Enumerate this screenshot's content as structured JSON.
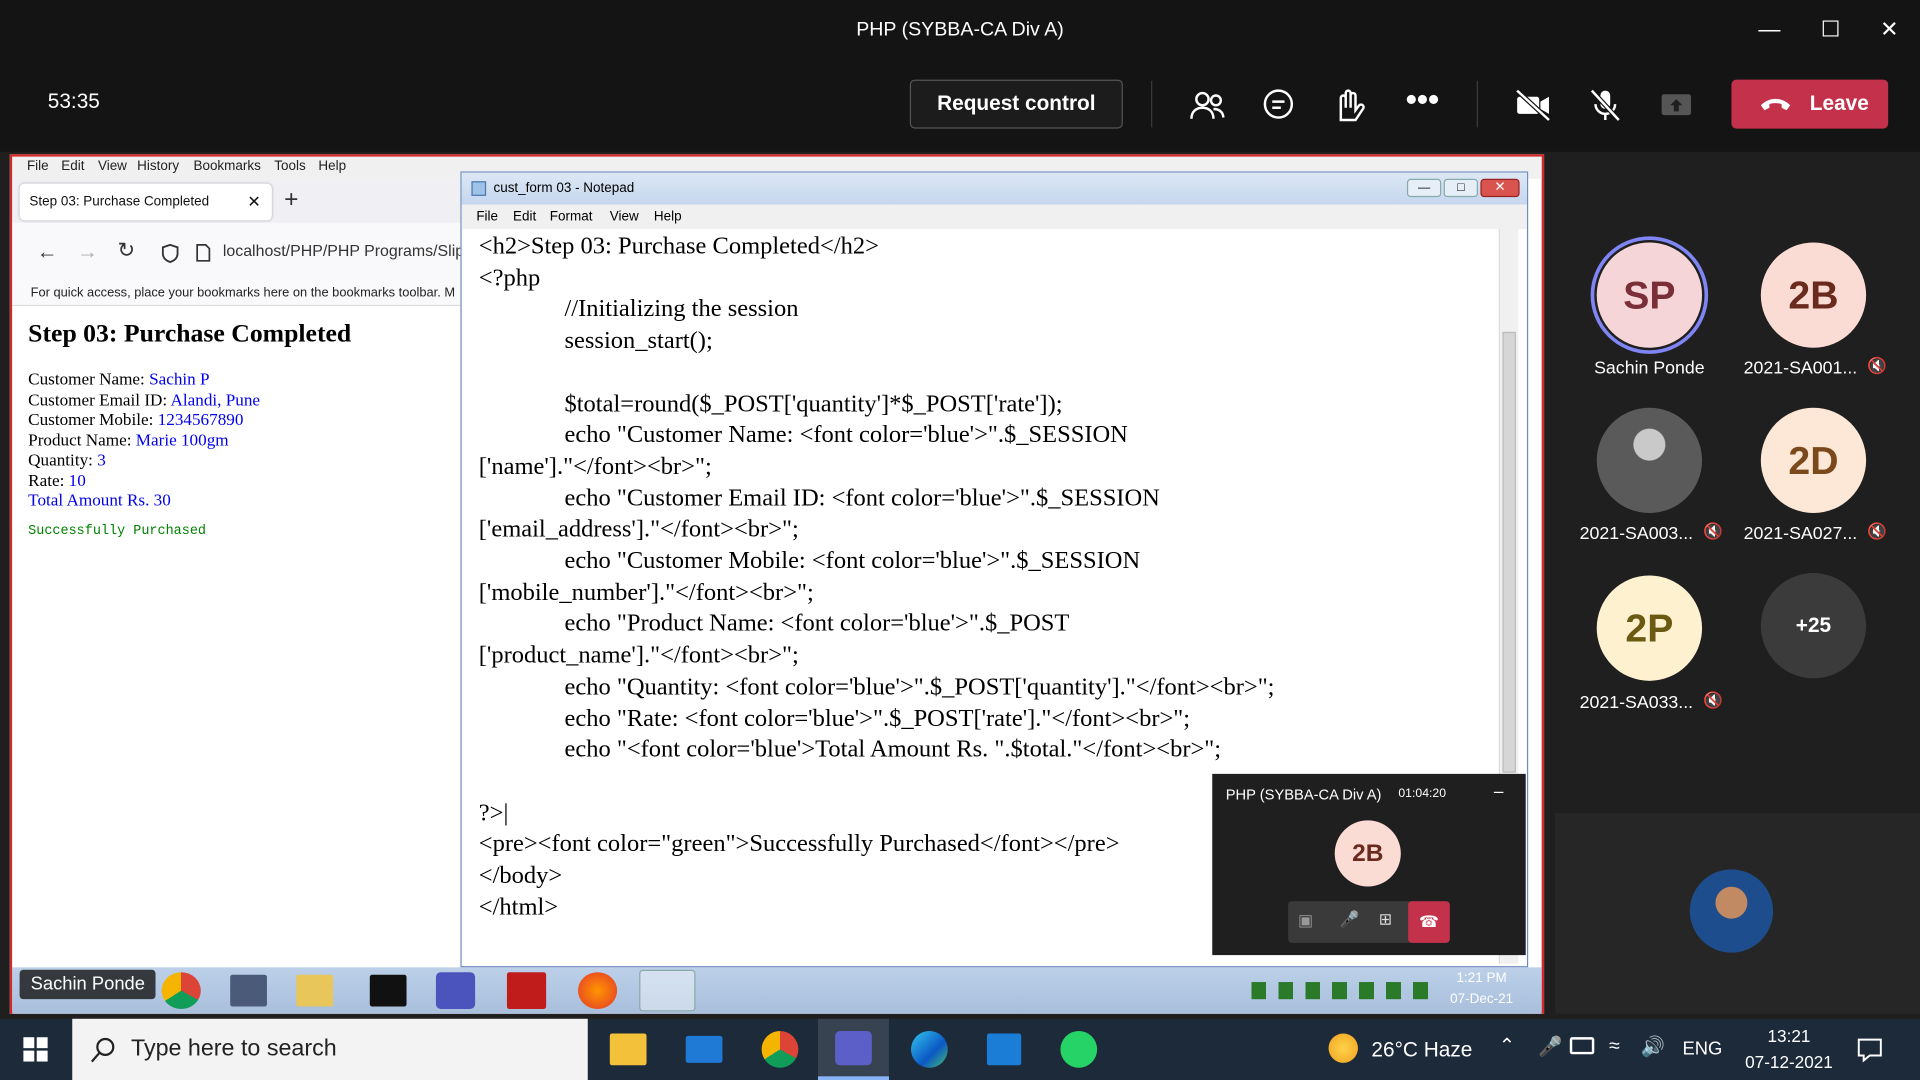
{
  "window": {
    "title": "PHP (SYBBA-CA Div A)"
  },
  "meeting": {
    "timer": "53:35",
    "request_control": "Request control",
    "leave": "Leave"
  },
  "firefox": {
    "menu": [
      "File",
      "Edit",
      "View",
      "History",
      "Bookmarks",
      "Tools",
      "Help"
    ],
    "tab_title": "Step 03: Purchase Completed",
    "url": "localhost/PHP/PHP Programs/Slip",
    "bookmarks_hint": "For quick access, place your bookmarks here on the bookmarks toolbar. M",
    "page": {
      "heading": "Step 03: Purchase Completed",
      "lines": [
        {
          "label": "Customer Name: ",
          "value": "Sachin P"
        },
        {
          "label": "Customer Email ID: ",
          "value": "Alandi, Pune"
        },
        {
          "label": "Customer Mobile: ",
          "value": "1234567890"
        },
        {
          "label": "Product Name: ",
          "value": "Marie 100gm"
        },
        {
          "label": "Quantity: ",
          "value": "3"
        },
        {
          "label": "Rate: ",
          "value": "10"
        },
        {
          "label": "",
          "value": "Total Amount Rs. 30"
        }
      ],
      "success": "Successfully Purchased"
    }
  },
  "notepad": {
    "title": "cust_form 03 - Notepad",
    "menu": [
      "File",
      "Edit",
      "Format",
      "View",
      "Help"
    ],
    "content": "<h2>Step 03: Purchase Completed</h2>\n<?php\n              //Initializing the session\n              session_start();\n\n              $total=round($_POST['quantity']*$_POST['rate']);\n              echo \"Customer Name: <font color='blue'>\".$_SESSION\n['name'].\"</font><br>\";\n              echo \"Customer Email ID: <font color='blue'>\".$_SESSION\n['email_address'].\"</font><br>\";\n              echo \"Customer Mobile: <font color='blue'>\".$_SESSION\n['mobile_number'].\"</font><br>\";\n              echo \"Product Name: <font color='blue'>\".$_POST\n['product_name'].\"</font><br>\";\n              echo \"Quantity: <font color='blue'>\".$_POST['quantity'].\"</font><br>\";\n              echo \"Rate: <font color='blue'>\".$_POST['rate'].\"</font><br>\";\n              echo \"<font color='blue'>Total Amount Rs. \".$total.\"</font><br>\";\n\n?>|\n<pre><font color=\"green\">Successfully Purchased</font></pre>\n</body>\n</html>"
  },
  "mini_call": {
    "title": "PHP (SYBBA-CA Div A)",
    "time": "01:04:20",
    "avatar": "2B"
  },
  "inner_taskbar": {
    "presenter": "Sachin Ponde",
    "time": "1:21 PM",
    "date": "07-Dec-21"
  },
  "participants": [
    {
      "initials": "SP",
      "name": "Sachin Ponde",
      "bg": "#f6d5d8",
      "fg": "#7a2e38"
    },
    {
      "initials": "2B",
      "name": "2021-SA001...",
      "bg": "#fbdcd4",
      "fg": "#6b2a1e"
    },
    {
      "initials": "",
      "name": "2021-SA003...",
      "bg": "#7b7b7b",
      "fg": "#fff"
    },
    {
      "initials": "2D",
      "name": "2021-SA027...",
      "bg": "#fde7d6",
      "fg": "#7a4a1c"
    },
    {
      "initials": "2P",
      "name": "2021-SA033...",
      "bg": "#fdf1cf",
      "fg": "#6b5a12"
    },
    {
      "initials": "+25",
      "name": "",
      "bg": "#3b3b3b",
      "fg": "#fff"
    }
  ],
  "taskbar": {
    "search_placeholder": "Type here to search",
    "weather": "26°C  Haze",
    "lang": "ENG",
    "time": "13:21",
    "date": "07-12-2021"
  }
}
